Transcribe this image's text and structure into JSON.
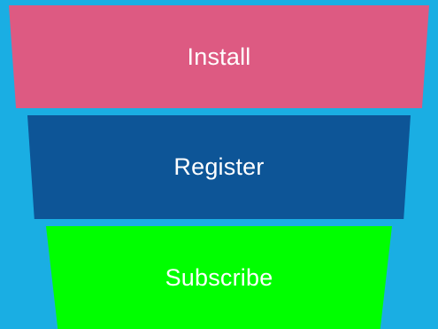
{
  "funnel": {
    "stages": [
      {
        "label": "Install",
        "color": "#dd5a82"
      },
      {
        "label": "Register",
        "color": "#0d5597"
      },
      {
        "label": "Subscribe",
        "color": "#00ff00"
      }
    ]
  },
  "colors": {
    "background": "#1aaee3",
    "label": "#ffffff"
  }
}
